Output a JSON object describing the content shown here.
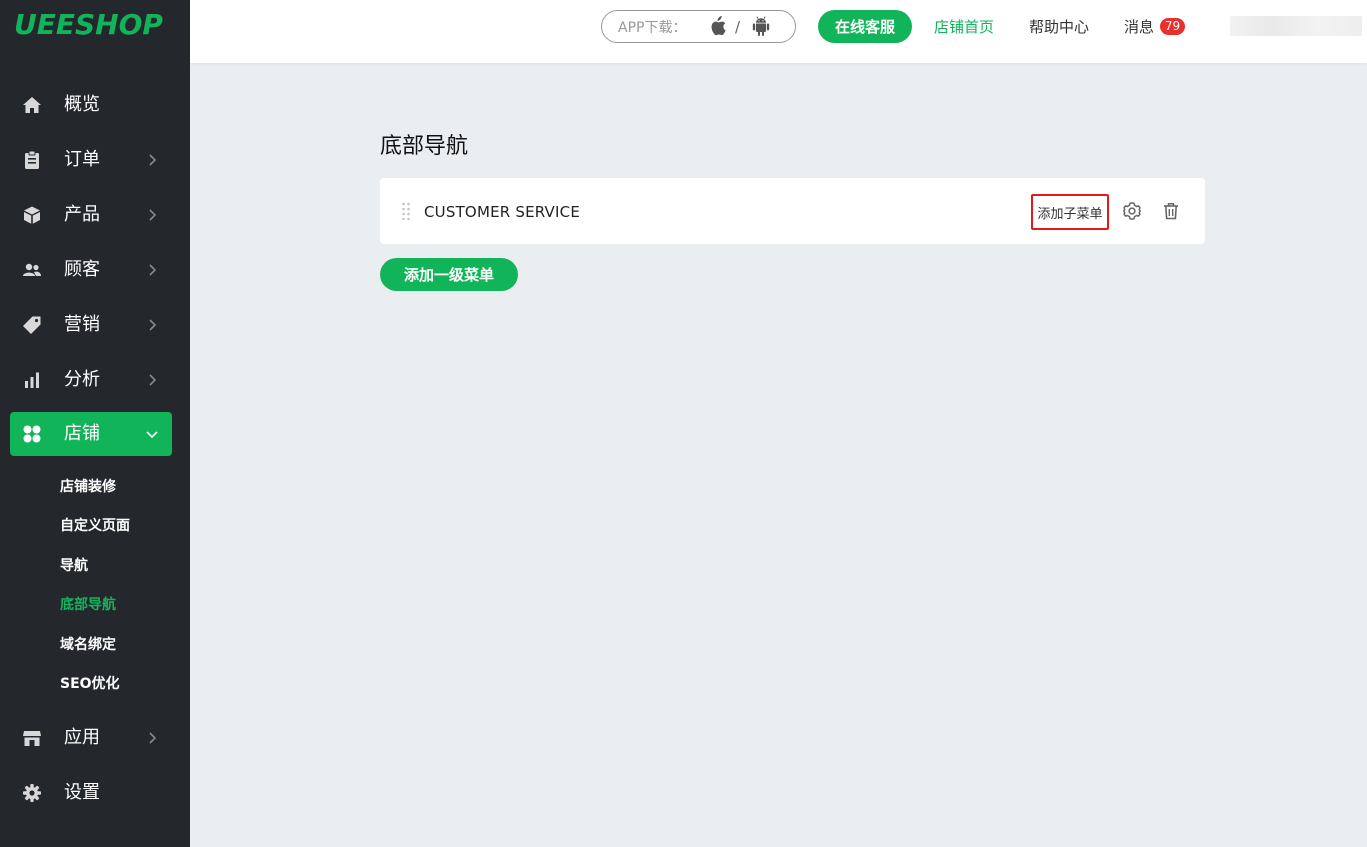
{
  "brand": {
    "logo_text": "UEESHOP",
    "accent_color": "#12b459"
  },
  "header": {
    "app_download_label": "APP下载：",
    "app_download_separator": "/",
    "service_button": "在线客服",
    "store_home": "店铺首页",
    "help_center": "帮助中心",
    "messages_label": "消息",
    "messages_count": "79"
  },
  "sidebar": {
    "items": [
      {
        "label": "概览",
        "icon": "home-icon"
      },
      {
        "label": "订单",
        "icon": "clipboard-icon"
      },
      {
        "label": "产品",
        "icon": "box-icon"
      },
      {
        "label": "顾客",
        "icon": "users-icon"
      },
      {
        "label": "营销",
        "icon": "tag-icon"
      },
      {
        "label": "分析",
        "icon": "bar-chart-icon"
      },
      {
        "label": "店铺",
        "icon": "grid-icon",
        "active": true
      },
      {
        "label": "应用",
        "icon": "store-icon"
      },
      {
        "label": "设置",
        "icon": "gear-icon"
      }
    ],
    "sub_items": [
      {
        "label": "店铺装修"
      },
      {
        "label": "自定义页面"
      },
      {
        "label": "导航"
      },
      {
        "label": "底部导航",
        "active": true
      },
      {
        "label": "域名绑定"
      },
      {
        "label": "SEO优化"
      }
    ]
  },
  "main": {
    "title": "底部导航",
    "menus": [
      {
        "name": "CUSTOMER SERVICE",
        "add_sub_label": "添加子菜单"
      }
    ],
    "add_top_menu_label": "添加一级菜单"
  }
}
